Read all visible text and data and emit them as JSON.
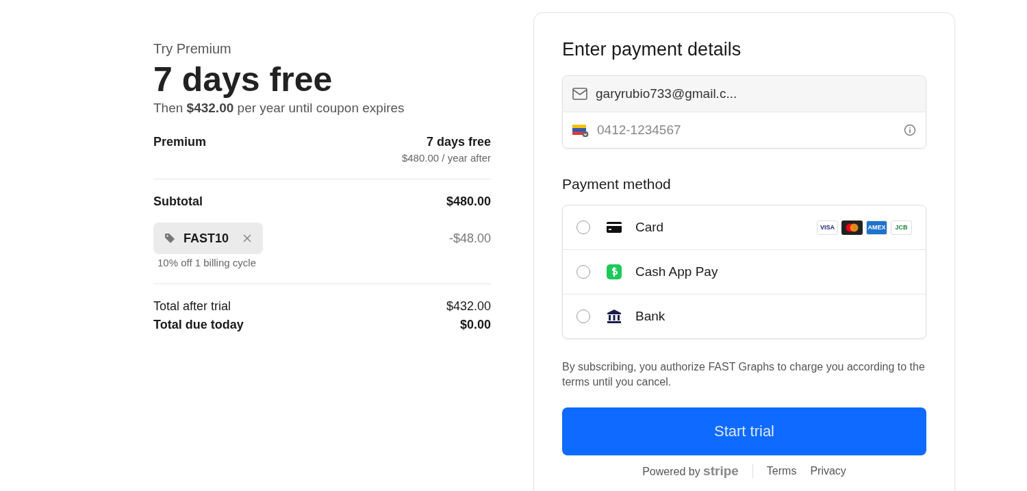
{
  "summary": {
    "eyebrow": "Try Premium",
    "headline": "7 days free",
    "subline": "Then **$432.00** per year until coupon expires",
    "plan": {
      "name": "Premium",
      "price": "7 days free",
      "note": "$480.00 / year after"
    },
    "subtotal": {
      "label": "Subtotal",
      "value": "$480.00"
    },
    "coupon": {
      "code": "FAST10",
      "amount": "-$48.00",
      "note": "10% off 1 billing cycle"
    },
    "total_after_trial": {
      "label": "Total after trial",
      "value": "$432.00"
    },
    "total_due": {
      "label": "Total due today",
      "value": "$0.00"
    }
  },
  "payment": {
    "title": "Enter payment details",
    "email": {
      "value": "garyrubio733@gmail.c..."
    },
    "phone": {
      "placeholder": "0412-1234567"
    },
    "method_title": "Payment method",
    "methods": [
      {
        "kind": "card",
        "label": "Card",
        "selected": false,
        "brands": [
          {
            "kind": "visa",
            "label": "VISA"
          },
          {
            "kind": "mastercard"
          },
          {
            "kind": "amex",
            "label": "AMEX"
          },
          {
            "kind": "jcb",
            "label": "JCB"
          }
        ]
      },
      {
        "kind": "cashapp",
        "label": "Cash App Pay",
        "selected": false
      },
      {
        "kind": "bank",
        "label": "Bank",
        "selected": false
      }
    ],
    "legal": "By subscribing, you authorize FAST Graphs to charge you according to the terms until you cancel.",
    "submit": "Start trial",
    "footer": {
      "powered": "Powered by",
      "brand": "stripe",
      "links": [
        "Terms",
        "Privacy"
      ]
    }
  }
}
